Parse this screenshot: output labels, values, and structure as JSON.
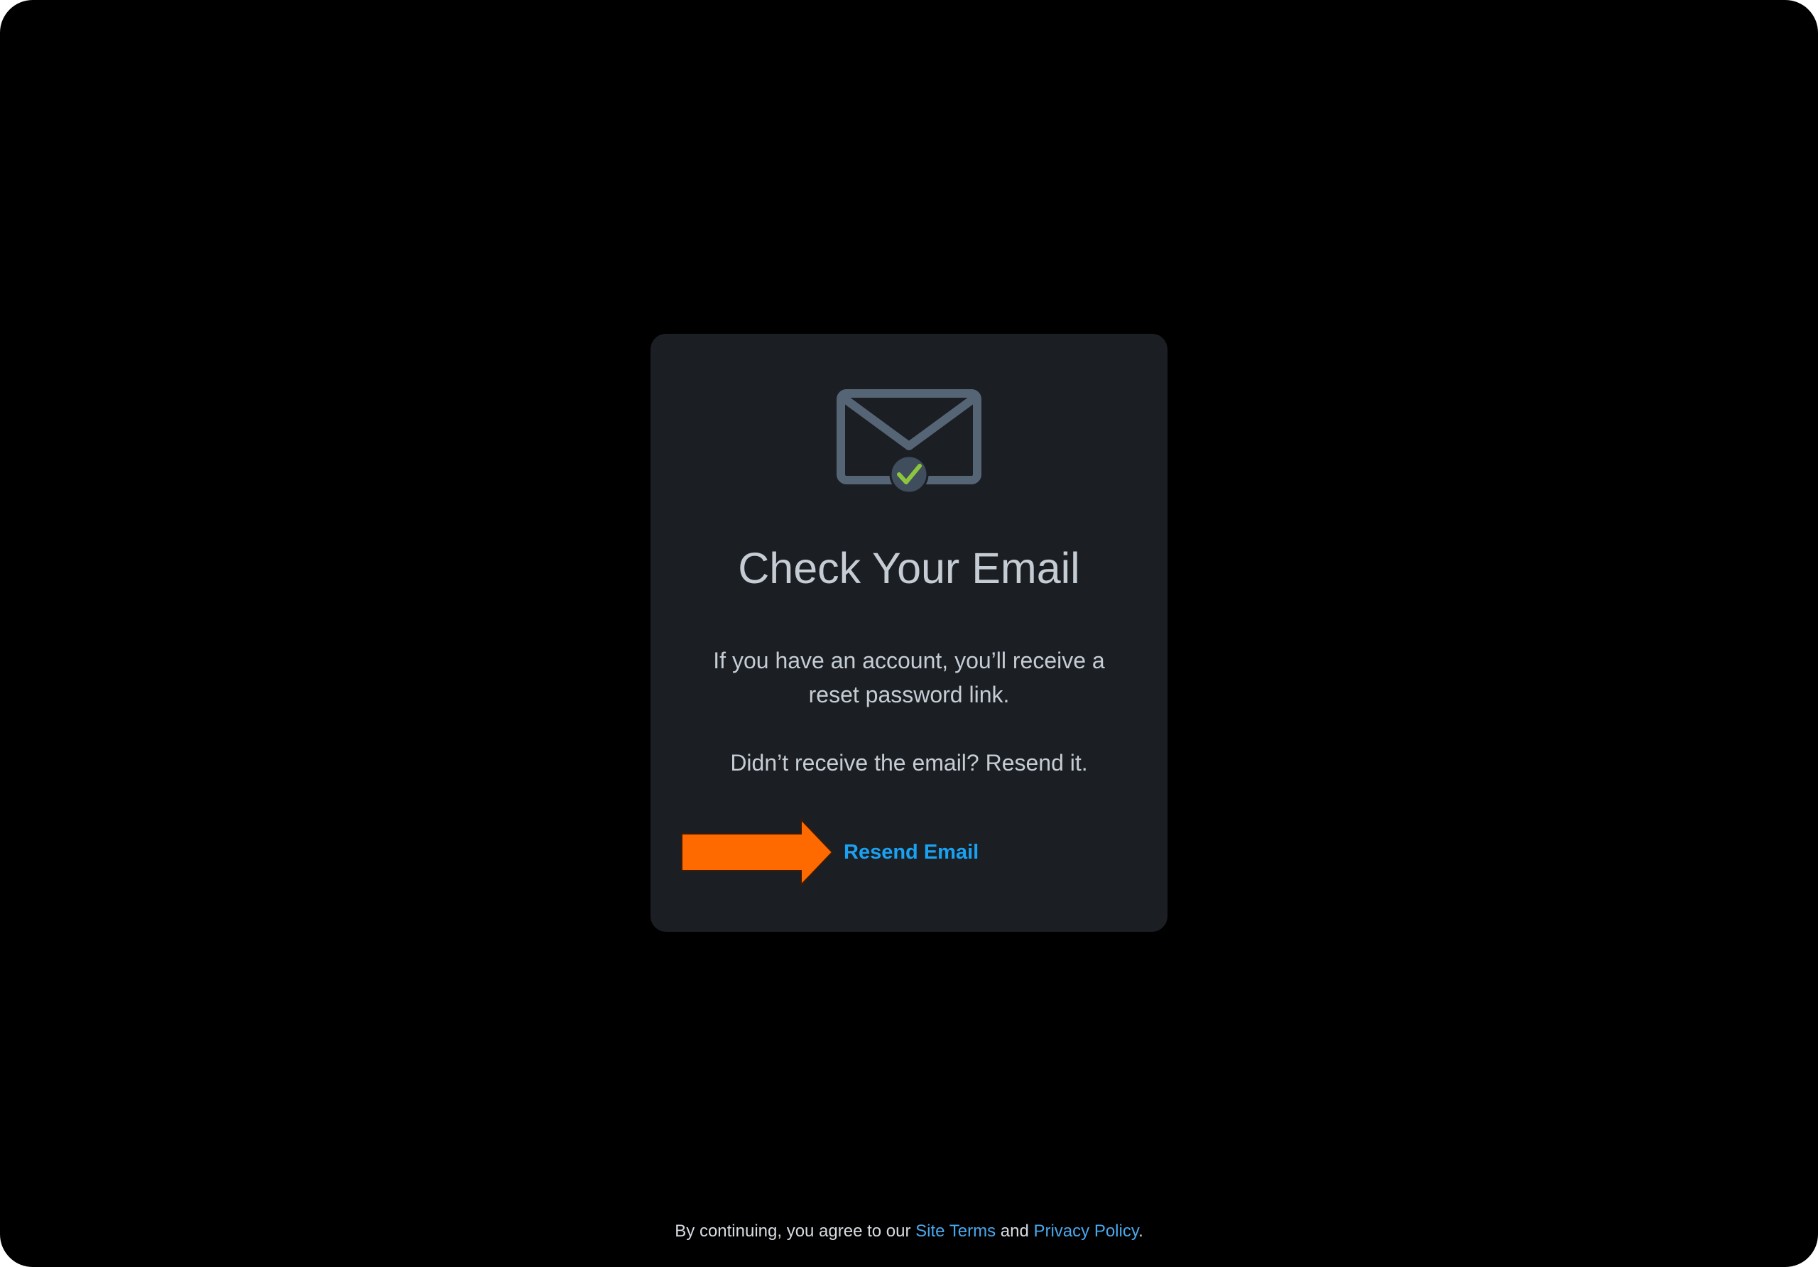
{
  "card": {
    "title": "Check Your Email",
    "message": "If you have an account, you’ll receive a reset password link.",
    "resend_prompt": "Didn’t receive the email? Resend it.",
    "resend_label": "Resend Email",
    "icon": "envelope-check-icon"
  },
  "footer": {
    "prefix": "By continuing, you agree to our ",
    "terms_label": "Site Terms",
    "conjunction": " and ",
    "privacy_label": "Privacy Policy",
    "suffix": "."
  },
  "colors": {
    "page_background": "#000000",
    "card_background": "#1b1f24",
    "text": "#c6ccd4",
    "link": "#1ba1f2",
    "annotation_arrow": "#ff6a00",
    "check": "#8cc63f"
  }
}
